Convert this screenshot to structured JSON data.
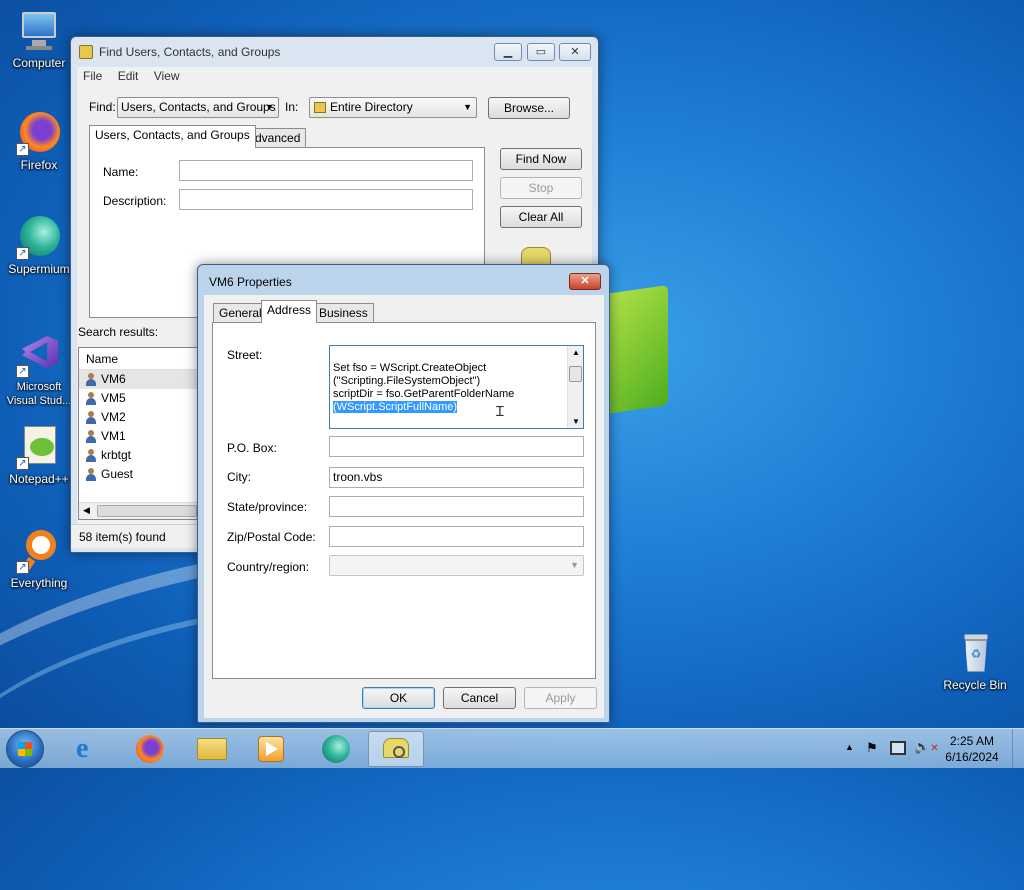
{
  "desktop": {
    "icons": [
      {
        "label": "Computer",
        "icon": "computer-icon"
      },
      {
        "label": "Firefox",
        "icon": "firefox-icon"
      },
      {
        "label": "Supermium",
        "icon": "supermium-icon"
      },
      {
        "label": "Microsoft Visual Stud...",
        "icon": "visual-studio-icon"
      },
      {
        "label": "Notepad++",
        "icon": "notepadpp-icon"
      },
      {
        "label": "Everything",
        "icon": "everything-icon"
      },
      {
        "label": "Recycle Bin",
        "icon": "recycle-bin-icon"
      }
    ]
  },
  "find_window": {
    "title": "Find Users, Contacts, and Groups",
    "menu": [
      "File",
      "Edit",
      "View"
    ],
    "find_label": "Find:",
    "find_value": "Users, Contacts, and Groups",
    "in_label": "In:",
    "in_value": "Entire Directory",
    "browse_label": "Browse...",
    "tabs": [
      "Users, Contacts, and Groups",
      "Advanced"
    ],
    "name_label": "Name:",
    "description_label": "Description:",
    "find_now_label": "Find Now",
    "stop_label": "Stop",
    "clear_all_label": "Clear All",
    "search_results_label": "Search results:",
    "column_name": "Name",
    "results": [
      "VM6",
      "VM5",
      "VM2",
      "VM1",
      "krbtgt",
      "Guest"
    ],
    "status": "58 item(s) found"
  },
  "props_window": {
    "title": "VM6 Properties",
    "tabs": [
      "General",
      "Address",
      "Business"
    ],
    "street_label": "Street:",
    "street_lines": [
      "Set fso = WScript.CreateObject",
      "(\"Scripting.FileSystemObject\")",
      "scriptDir = fso.GetParentFolderName"
    ],
    "street_selected": "(WScript.ScriptFullName)",
    "pobox_label": "P.O. Box:",
    "pobox_value": "",
    "city_label": "City:",
    "city_value": "troon.vbs",
    "state_label": "State/province:",
    "state_value": "",
    "zip_label": "Zip/Postal Code:",
    "zip_value": "",
    "country_label": "Country/region:",
    "country_value": "",
    "ok_label": "OK",
    "cancel_label": "Cancel",
    "apply_label": "Apply"
  },
  "taskbar": {
    "time": "2:25 AM",
    "date": "6/16/2024"
  }
}
